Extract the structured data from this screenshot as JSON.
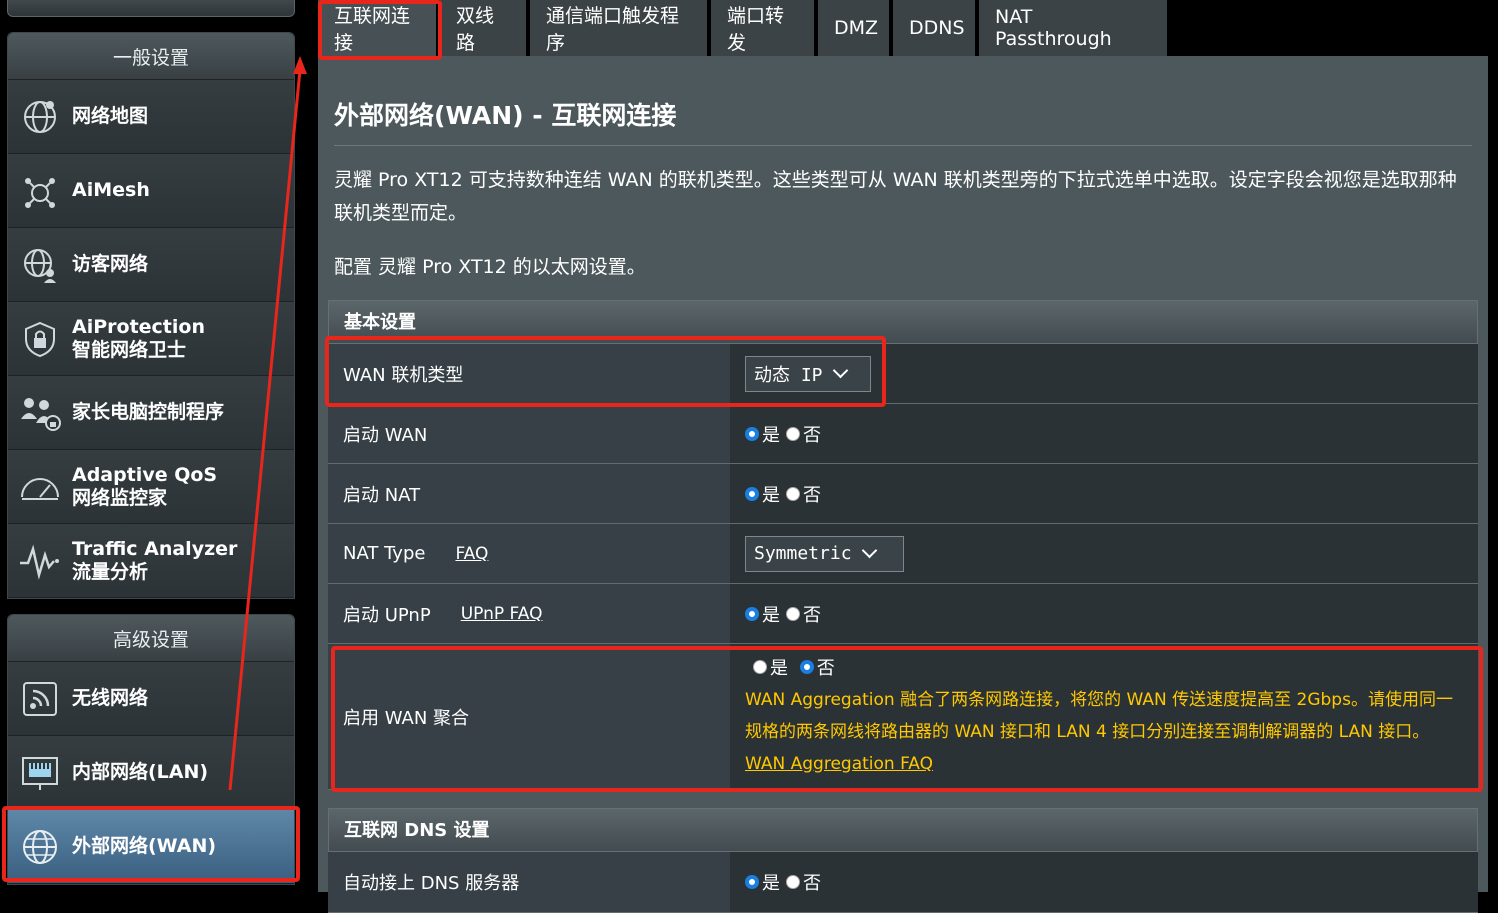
{
  "sidebar": {
    "general_header": "一般设置",
    "general_items": [
      {
        "label": "网络地图",
        "icon": "globe-network-icon"
      },
      {
        "label": "AiMesh",
        "icon": "aimesh-icon"
      },
      {
        "label": "访客网络",
        "icon": "guest-network-icon"
      },
      {
        "label": "AiProtection",
        "label2": "智能网络卫士",
        "icon": "shield-lock-icon"
      },
      {
        "label": "家长电脑控制程序",
        "icon": "family-users-icon"
      },
      {
        "label": "Adaptive QoS",
        "label2": "网络监控家",
        "icon": "speedometer-icon"
      },
      {
        "label": "Traffic Analyzer",
        "label2": "流量分析",
        "icon": "traffic-wave-icon"
      }
    ],
    "advanced_header": "高级设置",
    "advanced_items": [
      {
        "label": "无线网络",
        "icon": "wireless-icon"
      },
      {
        "label": "内部网络(LAN)",
        "icon": "lan-port-icon"
      },
      {
        "label": "外部网络(WAN)",
        "icon": "wan-globe-icon"
      }
    ]
  },
  "tabs": [
    "互联网连接",
    "双线路",
    "通信端口触发程序",
    "端口转发",
    "DMZ",
    "DDNS",
    "NAT Passthrough"
  ],
  "main": {
    "title": "外部网络(WAN) - 互联网连接",
    "description": "灵耀 Pro XT12 可支持数种连结 WAN 的联机类型。这些类型可从 WAN 联机类型旁的下拉式选单中选取。设定字段会视您是选取那种联机类型而定。",
    "description2": "配置 灵耀 Pro XT12 的以太网设置。",
    "basic_section": "基本设置",
    "rows": {
      "wan_type_label": "WAN 联机类型",
      "wan_type_value": "动态 IP",
      "enable_wan_label": "启动 WAN",
      "enable_nat_label": "启动 NAT",
      "nat_type_label": "NAT Type",
      "nat_type_faq": "FAQ",
      "nat_type_value": "Symmetric",
      "enable_upnp_label": "启动 UPnP",
      "upnp_faq": "UPnP  FAQ",
      "wan_aggregation_label": "启用 WAN 聚合",
      "wan_aggregation_note": "WAN Aggregation 融合了两条网路连接，将您的 WAN 传送速度提高至 2Gbps。请使用同一规格的两条网线将路由器的 WAN 接口和 LAN 4 接口分别连接至调制解调器的 LAN 接口。",
      "wan_aggregation_faq": "WAN Aggregation FAQ"
    },
    "dns_section": "互联网 DNS 设置",
    "dns_auto_label": "自动接上 DNS 服务器",
    "yes": "是",
    "no": "否"
  },
  "colors": {
    "highlight": "#e8261c",
    "warning_text": "#ffc800",
    "radio_selected": "#1a7fe0"
  }
}
